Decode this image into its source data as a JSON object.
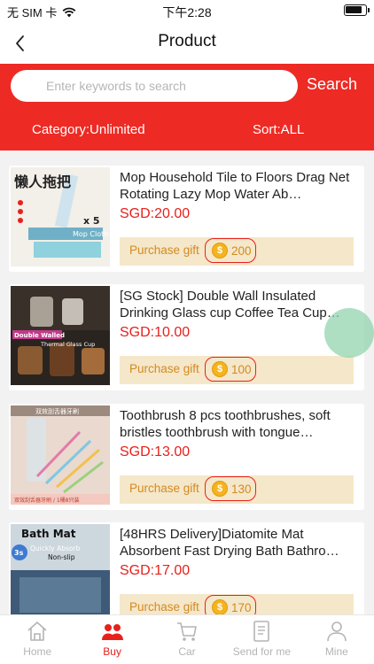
{
  "status": {
    "carrier": "无 SIM 卡",
    "time": "下午2:28",
    "battery_level": 0.85
  },
  "header": {
    "title": "Product"
  },
  "search": {
    "placeholder": "Enter keywords to search",
    "button_label": "Search"
  },
  "filters": {
    "category": "Category:Unlimited",
    "sort": "Sort:ALL"
  },
  "products": [
    {
      "title": "Mop Household Tile to Floors Drag Net Rotating Lazy Mop Water Ab…",
      "price": "SGD:20.00",
      "gift_label": "Purchase gift",
      "coins": "200",
      "image_text": [
        "懒人拖把",
        "x 5",
        "Mop Cloth"
      ]
    },
    {
      "title": "[SG Stock] Double Wall Insulated Drinking Glass cup Coffee Tea Cup…",
      "price": "SGD:10.00",
      "gift_label": "Purchase gift",
      "coins": "100",
      "image_text": [
        "Double Walled",
        "Thermal Glass Cup"
      ]
    },
    {
      "title": "Toothbrush 8 pcs toothbrushes, soft bristles toothbrush with tongue…",
      "price": "SGD:13.00",
      "gift_label": "Purchase gift",
      "coins": "130",
      "image_text": [
        "双效刮舌器牙刷",
        "双效刮舌器牙刷 / 1桶8只装"
      ]
    },
    {
      "title": "[48HRS Delivery]Diatomite Mat Absorbent Fast Drying Bath Bathro…",
      "price": "SGD:17.00",
      "gift_label": "Purchase gift",
      "coins": "170",
      "image_text": [
        "Bath Mat",
        "Quickly Absorb",
        "Non-slip",
        "3s"
      ]
    }
  ],
  "tabs": [
    {
      "label": "Home",
      "icon": "home-icon",
      "active": false
    },
    {
      "label": "Buy",
      "icon": "buy-icon",
      "active": true
    },
    {
      "label": "Car",
      "icon": "cart-icon",
      "active": false
    },
    {
      "label": "Send for me",
      "icon": "send-icon",
      "active": false
    },
    {
      "label": "Mine",
      "icon": "person-icon",
      "active": false
    }
  ],
  "colors": {
    "brand_red": "#ee2a24",
    "price_red": "#e8201b",
    "gift_bg": "#f5e7c9",
    "gift_text": "#d38a22"
  }
}
